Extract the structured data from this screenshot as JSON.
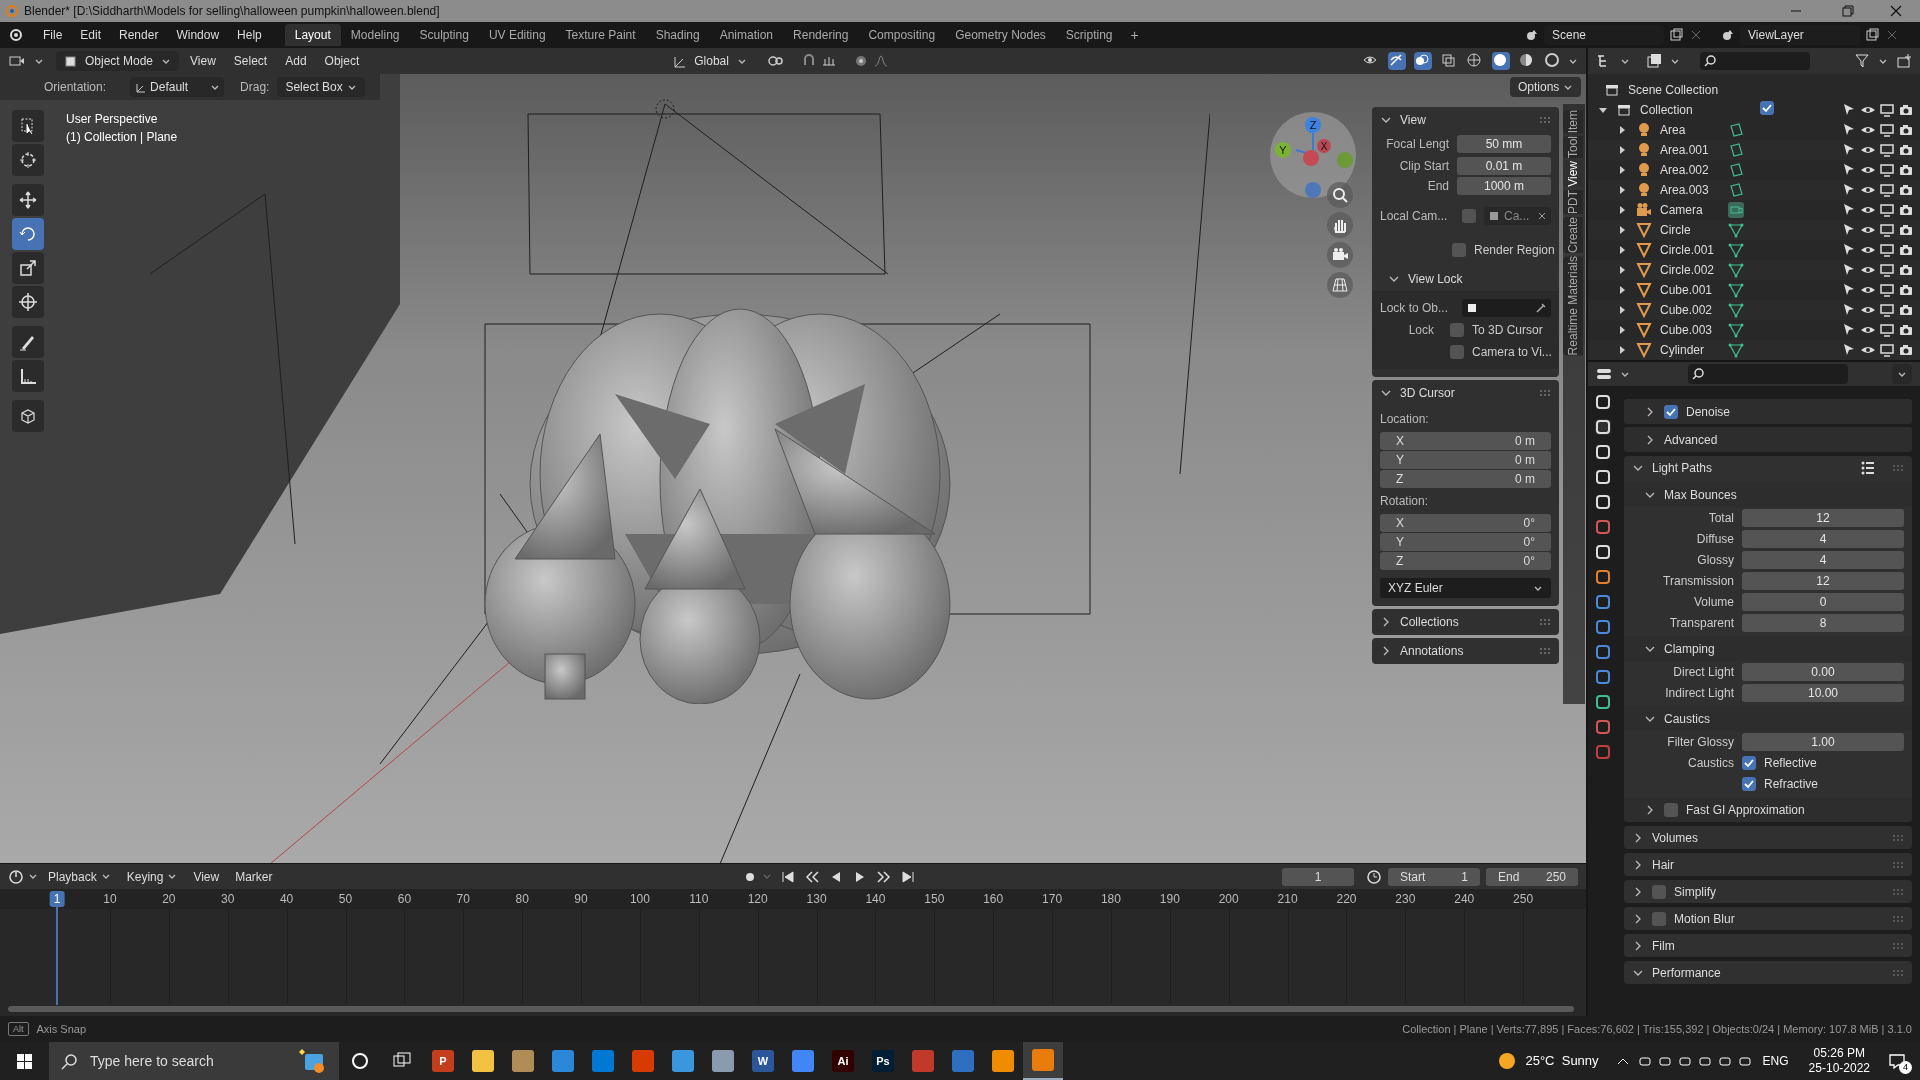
{
  "window": {
    "title": "Blender* [D:\\Siddharth\\Models for selling\\halloween pumpkin\\halloween.blend]"
  },
  "menu": [
    "File",
    "Edit",
    "Render",
    "Window",
    "Help"
  ],
  "workspaces": [
    {
      "label": "Layout",
      "selected": true
    },
    {
      "label": "Modeling",
      "selected": false
    },
    {
      "label": "Sculpting",
      "selected": false
    },
    {
      "label": "UV Editing",
      "selected": false
    },
    {
      "label": "Texture Paint",
      "selected": false
    },
    {
      "label": "Shading",
      "selected": false
    },
    {
      "label": "Animation",
      "selected": false
    },
    {
      "label": "Rendering",
      "selected": false
    },
    {
      "label": "Compositing",
      "selected": false
    },
    {
      "label": "Geometry Nodes",
      "selected": false
    },
    {
      "label": "Scripting",
      "selected": false
    }
  ],
  "add_workspace": "+",
  "scene": "Scene",
  "view_layer": "ViewLayer",
  "viewport_header": {
    "mode": "Object Mode",
    "menus": [
      "View",
      "Select",
      "Add",
      "Object"
    ],
    "transform": "Global"
  },
  "tool_settings": {
    "orientation_label": "Orientation:",
    "orientation": "Default",
    "drag_label": "Drag:",
    "drag": "Select Box",
    "options": "Options"
  },
  "viewport": {
    "perspective": "User Perspective",
    "context": "(1) Collection | Plane"
  },
  "gizmo": {
    "z": "Z",
    "y": "Y",
    "x": "X"
  },
  "tools": [
    {
      "kind": "select",
      "selected": false
    },
    {
      "kind": "cursor",
      "selected": false
    },
    {
      "kind": "move",
      "selected": false
    },
    {
      "kind": "rotate",
      "selected": true
    },
    {
      "kind": "scale",
      "selected": false
    },
    {
      "kind": "transform",
      "selected": false
    },
    {
      "kind": "annotate",
      "selected": false
    },
    {
      "kind": "measure",
      "selected": false
    },
    {
      "kind": "add",
      "selected": false
    }
  ],
  "sidebar_tabs": [
    {
      "label": "Item",
      "selected": false
    },
    {
      "label": "Tool",
      "selected": false
    },
    {
      "label": "View",
      "selected": true
    },
    {
      "label": "PDT",
      "selected": false
    },
    {
      "label": "Create",
      "selected": false
    },
    {
      "label": "Realtime Materials",
      "selected": false
    }
  ],
  "view_panel": {
    "title": "View",
    "fields": [
      {
        "label": "Focal Lengt",
        "value": "50 mm"
      },
      {
        "label": "Clip Start",
        "value": "0.01 m"
      },
      {
        "label": "End",
        "value": "1000 m"
      }
    ],
    "local_camera": {
      "label": "Local Cam...",
      "checked": false,
      "value": "Ca..."
    },
    "render_region": {
      "label": "Render Region",
      "checked": false
    },
    "view_lock": {
      "title": "View Lock",
      "lock_to_label": "Lock to Ob...",
      "lock_label": "Lock",
      "options": [
        {
          "label": "To 3D Cursor",
          "checked": false
        },
        {
          "label": "Camera to Vi...",
          "checked": false
        }
      ]
    }
  },
  "cursor_panel": {
    "title": "3D Cursor",
    "location_label": "Location:",
    "location": [
      {
        "axis": "X",
        "value": "0 m"
      },
      {
        "axis": "Y",
        "value": "0 m"
      },
      {
        "axis": "Z",
        "value": "0 m"
      }
    ],
    "rotation_label": "Rotation:",
    "rotation": [
      {
        "axis": "X",
        "value": "0°"
      },
      {
        "axis": "Y",
        "value": "0°"
      },
      {
        "axis": "Z",
        "value": "0°"
      }
    ],
    "rotation_mode": "XYZ Euler"
  },
  "collapsed_panels": [
    "Collections",
    "Annotations"
  ],
  "outliner": {
    "root": "Scene Collection",
    "collection": {
      "name": "Collection",
      "checked": true,
      "children": [
        {
          "name": "Area",
          "kind": "light"
        },
        {
          "name": "Area.001",
          "kind": "light"
        },
        {
          "name": "Area.002",
          "kind": "light"
        },
        {
          "name": "Area.003",
          "kind": "light"
        },
        {
          "name": "Camera",
          "kind": "camera"
        },
        {
          "name": "Circle",
          "kind": "mesh"
        },
        {
          "name": "Circle.001",
          "kind": "mesh"
        },
        {
          "name": "Circle.002",
          "kind": "mesh"
        },
        {
          "name": "Cube.001",
          "kind": "mesh"
        },
        {
          "name": "Cube.002",
          "kind": "mesh"
        },
        {
          "name": "Cube.003",
          "kind": "mesh"
        },
        {
          "name": "Cylinder",
          "kind": "mesh"
        }
      ]
    }
  },
  "properties": [
    {
      "kind": "subpanel",
      "label": "Denoise",
      "expanded": false,
      "checked": true
    },
    {
      "kind": "subpanel",
      "label": "Advanced",
      "expanded": false
    },
    {
      "kind": "panel",
      "label": "Light Paths",
      "expanded": true
    },
    {
      "kind": "subpanel",
      "label": "Max Bounces",
      "expanded": true
    },
    {
      "kind": "field",
      "label": "Total",
      "value": "12"
    },
    {
      "kind": "field",
      "label": "Diffuse",
      "value": "4"
    },
    {
      "kind": "field",
      "label": "Glossy",
      "value": "4"
    },
    {
      "kind": "field",
      "label": "Transmission",
      "value": "12"
    },
    {
      "kind": "field",
      "label": "Volume",
      "value": "0"
    },
    {
      "kind": "field",
      "label": "Transparent",
      "value": "8"
    },
    {
      "kind": "subpanel",
      "label": "Clamping",
      "expanded": true
    },
    {
      "kind": "field",
      "label": "Direct Light",
      "value": "0.00"
    },
    {
      "kind": "field",
      "label": "Indirect Light",
      "value": "10.00"
    },
    {
      "kind": "subpanel",
      "label": "Caustics",
      "expanded": true
    },
    {
      "kind": "field",
      "label": "Filter Glossy",
      "value": "1.00"
    },
    {
      "kind": "checkbox",
      "label": "Caustics",
      "text": "Reflective",
      "checked": true
    },
    {
      "kind": "checkbox",
      "text": "Refractive",
      "checked": true
    },
    {
      "kind": "subpanel",
      "label": "Fast GI Approximation",
      "expanded": false,
      "checked": false
    },
    {
      "kind": "panel",
      "label": "Volumes",
      "expanded": false
    },
    {
      "kind": "panel",
      "label": "Hair",
      "expanded": false
    },
    {
      "kind": "panel",
      "label": "Simplify",
      "expanded": false,
      "checked": false
    },
    {
      "kind": "panel",
      "label": "Motion Blur",
      "expanded": false,
      "checked": false
    },
    {
      "kind": "panel",
      "label": "Film",
      "expanded": false
    },
    {
      "kind": "panel",
      "label": "Performance",
      "expanded": true
    }
  ],
  "timeline": {
    "menus": [
      "Playback",
      "Keying",
      "View",
      "Marker"
    ],
    "current_frame": "1",
    "start_label": "Start",
    "start": "1",
    "end_label": "End",
    "end": "250",
    "ruler": [
      "1",
      "10",
      "20",
      "30",
      "40",
      "50",
      "60",
      "70",
      "80",
      "90",
      "100",
      "110",
      "120",
      "130",
      "140",
      "150",
      "160",
      "170",
      "180",
      "190",
      "200",
      "210",
      "220",
      "230",
      "240",
      "250"
    ]
  },
  "status_bar": {
    "hint_key": "Alt",
    "hint": "Axis Snap",
    "stats": "Collection | Plane | Verts:77,895 | Faces:76,602 | Tris:155,392 | Objects:0/24 | Memory: 107.8 MiB | 3.1.0"
  },
  "taskbar": {
    "search_placeholder": "Type here to search",
    "apps": [
      {
        "label": "P",
        "color": "#c43e1c",
        "selected": false
      },
      {
        "color": "#f3c242",
        "selected": false
      },
      {
        "color": "#b08d57",
        "selected": false
      },
      {
        "color": "#2b88d8",
        "selected": false
      },
      {
        "color": "#0078d4",
        "selected": false
      },
      {
        "color": "#d83b01",
        "selected": false
      },
      {
        "color": "#3a96dd",
        "selected": false
      },
      {
        "color": "#8a9bb0",
        "selected": false
      },
      {
        "label": "W",
        "color": "#2b579a",
        "selected": false
      },
      {
        "color": "#4285f4",
        "selected": false
      },
      {
        "label": "Ai",
        "color": "#330000",
        "selected": false
      },
      {
        "label": "Ps",
        "color": "#001e36",
        "selected": false
      },
      {
        "color": "#c0392b",
        "selected": false
      },
      {
        "color": "#2f6fbf",
        "selected": false
      },
      {
        "color": "#f08c00",
        "selected": false
      },
      {
        "color": "#e87d0d",
        "selected": true
      }
    ],
    "weather": "25°C  Sunny",
    "language": "ENG",
    "time": "05:26 PM",
    "date": "25-10-2022",
    "notifications": "4"
  }
}
